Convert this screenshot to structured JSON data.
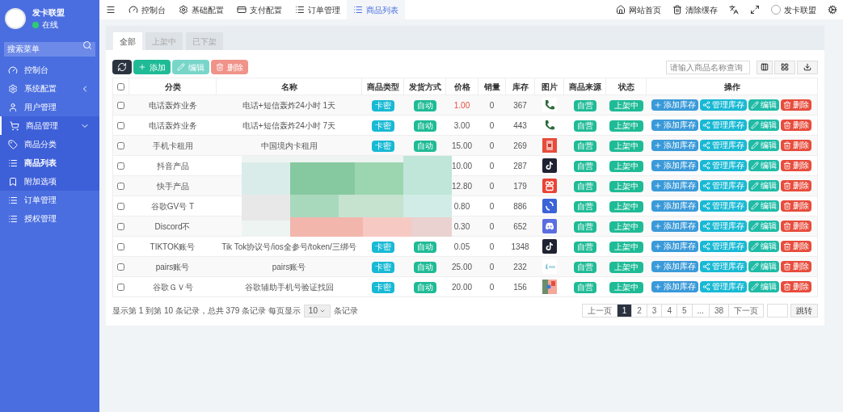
{
  "sidebar": {
    "user": {
      "name": "发卡联盟",
      "status": "在线",
      "online": true
    },
    "search": {
      "placeholder": "搜索菜单"
    },
    "items": [
      {
        "label": "控制台",
        "selected": false
      },
      {
        "label": "系统配置",
        "selected": false,
        "expanded": false
      },
      {
        "label": "用户管理",
        "selected": false
      },
      {
        "label": "商品管理",
        "selected": false,
        "expanded": true,
        "children": [
          {
            "label": "商品分类",
            "selected": false
          },
          {
            "label": "商品列表",
            "selected": true
          },
          {
            "label": "附加选项",
            "selected": false
          }
        ]
      },
      {
        "label": "订单管理",
        "selected": false
      },
      {
        "label": "授权管理",
        "selected": false
      }
    ]
  },
  "topbar": {
    "tabs": [
      {
        "label": "控制台",
        "selected": false
      },
      {
        "label": "基础配置",
        "selected": false
      },
      {
        "label": "支付配置",
        "selected": false
      },
      {
        "label": "订单管理",
        "selected": false
      },
      {
        "label": "商品列表",
        "selected": true
      }
    ],
    "links": [
      "网站首页",
      "清除缓存"
    ],
    "user": "发卡联盟"
  },
  "filter_tabs": [
    {
      "label": "全部",
      "selected": true
    },
    {
      "label": "上架中",
      "selected": false
    },
    {
      "label": "已下架",
      "selected": false
    }
  ],
  "toolbar": {
    "buttons": [
      {
        "kind": "refresh"
      },
      {
        "kind": "add",
        "label": "添加"
      },
      {
        "kind": "edit",
        "label": "编辑",
        "disabled": true
      },
      {
        "kind": "delete",
        "label": "删除",
        "disabled": true
      }
    ],
    "search": {
      "placeholder": "请输入商品名称查询"
    }
  },
  "table": {
    "select_all_checked": false,
    "columns": [
      "分类",
      "名称",
      "商品类型",
      "发货方式",
      "价格",
      "销量",
      "库存",
      "图片",
      "商品来源",
      "状态",
      "操作"
    ],
    "rows": [
      {
        "checked": false,
        "category": "电话轰炸业务",
        "name": "电话+短信轰炸24小时 1天",
        "type": "卡密",
        "delivery": "自动",
        "price": "1.00",
        "price_alert": true,
        "sales": "0",
        "stock": "367",
        "image": {
          "kind": "phone"
        },
        "source": "自营",
        "status": "上架中",
        "actions": [
          {
            "kind": "add",
            "label": "添加库存"
          },
          {
            "kind": "manage",
            "label": "管理库存"
          },
          {
            "kind": "edit",
            "label": "编辑"
          },
          {
            "kind": "delete",
            "label": "删除"
          }
        ]
      },
      {
        "checked": false,
        "category": "电话轰炸业务",
        "name": "电话+短信轰炸24小时 7天",
        "type": "卡密",
        "delivery": "自动",
        "price": "3.00",
        "price_alert": false,
        "sales": "0",
        "stock": "443",
        "image": {
          "kind": "phone"
        },
        "source": "自营",
        "status": "上架中",
        "actions": [
          {
            "kind": "add",
            "label": "添加库存"
          },
          {
            "kind": "manage",
            "label": "管理库存"
          },
          {
            "kind": "edit",
            "label": "编辑"
          },
          {
            "kind": "delete",
            "label": "删除"
          }
        ]
      },
      {
        "checked": false,
        "category": "手机卡租用",
        "name": "中国境内卡租用",
        "type": "卡密",
        "delivery": "自动",
        "price": "15.00",
        "price_alert": false,
        "sales": "0",
        "stock": "269",
        "image": {
          "kind": "sim"
        },
        "source": "自营",
        "status": "上架中",
        "actions": [
          {
            "kind": "add",
            "label": "添加库存"
          },
          {
            "kind": "manage",
            "label": "管理库存"
          },
          {
            "kind": "edit",
            "label": "编辑"
          },
          {
            "kind": "delete",
            "label": "删除"
          }
        ]
      },
      {
        "checked": false,
        "category": "抖音产品",
        "price": "10.00",
        "price_alert": false,
        "sales": "0",
        "stock": "287",
        "image": {
          "kind": "tiktok"
        },
        "source": "自营",
        "status": "上架中",
        "actions": [
          {
            "kind": "add",
            "label": "添加库存"
          },
          {
            "kind": "manage",
            "label": "管理库存"
          },
          {
            "kind": "edit",
            "label": "编辑"
          },
          {
            "kind": "delete",
            "label": "删除"
          }
        ]
      },
      {
        "checked": false,
        "category": "快手产品",
        "price": "12.80",
        "price_alert": false,
        "sales": "0",
        "stock": "179",
        "image": {
          "kind": "kuaishou"
        },
        "source": "自营",
        "status": "上架中",
        "actions": [
          {
            "kind": "add",
            "label": "添加库存"
          },
          {
            "kind": "manage",
            "label": "管理库存"
          },
          {
            "kind": "edit",
            "label": "编辑"
          },
          {
            "kind": "delete",
            "label": "删除"
          }
        ]
      },
      {
        "checked": false,
        "category": "谷歌GV号 T",
        "price": "0.80",
        "price_alert": false,
        "sales": "0",
        "stock": "886",
        "image": {
          "kind": "sync"
        },
        "source": "自营",
        "status": "上架中",
        "actions": [
          {
            "kind": "add",
            "label": "添加库存"
          },
          {
            "kind": "manage",
            "label": "管理库存"
          },
          {
            "kind": "edit",
            "label": "编辑"
          },
          {
            "kind": "delete",
            "label": "删除"
          }
        ]
      },
      {
        "checked": false,
        "category": "Discord不",
        "price": "0.30",
        "price_alert": false,
        "sales": "0",
        "stock": "652",
        "image": {
          "kind": "discord"
        },
        "source": "自营",
        "status": "上架中",
        "actions": [
          {
            "kind": "add",
            "label": "添加库存"
          },
          {
            "kind": "manage",
            "label": "管理库存"
          },
          {
            "kind": "edit",
            "label": "编辑"
          },
          {
            "kind": "delete",
            "label": "删除"
          }
        ]
      },
      {
        "checked": false,
        "category": "TIKTOK账号",
        "name": "Tik Tok协议号/ios全参号/token/三绑号",
        "type": "卡密",
        "delivery": "自动",
        "price": "0.05",
        "price_alert": false,
        "sales": "0",
        "stock": "1348",
        "image": {
          "kind": "tiktok"
        },
        "source": "自营",
        "status": "上架中",
        "actions": [
          {
            "kind": "add",
            "label": "添加库存"
          },
          {
            "kind": "manage",
            "label": "管理库存"
          },
          {
            "kind": "edit",
            "label": "编辑"
          },
          {
            "kind": "delete",
            "label": "删除"
          }
        ]
      },
      {
        "checked": false,
        "category": "pairs账号",
        "name": "pairs账号",
        "type": "卡密",
        "delivery": "自动",
        "price": "25.00",
        "price_alert": false,
        "sales": "0",
        "stock": "232",
        "image": {
          "kind": "pairs"
        },
        "source": "自营",
        "status": "上架中",
        "actions": [
          {
            "kind": "add",
            "label": "添加库存"
          },
          {
            "kind": "manage",
            "label": "管理库存"
          },
          {
            "kind": "edit",
            "label": "编辑"
          },
          {
            "kind": "delete",
            "label": "删除"
          }
        ]
      },
      {
        "checked": false,
        "category": "谷歌ＧＶ号",
        "name": "谷歌辅助手机号验证找回",
        "type": "卡密",
        "delivery": "自动",
        "price": "20.00",
        "price_alert": false,
        "sales": "0",
        "stock": "156",
        "image": {
          "kind": "map"
        },
        "source": "自营",
        "status": "上架中",
        "actions": [
          {
            "kind": "add",
            "label": "添加库存"
          },
          {
            "kind": "manage",
            "label": "管理库存"
          },
          {
            "kind": "edit",
            "label": "编辑"
          },
          {
            "kind": "delete",
            "label": "删除"
          }
        ]
      }
    ]
  },
  "footer": {
    "summary_before": "显示第 1 到第 10 条记录，总共 379 条记录 每页显示",
    "page_size": "10",
    "summary_after": "条记录",
    "pages": [
      {
        "label": "上一页",
        "selected": false
      },
      {
        "label": "1",
        "selected": true
      },
      {
        "label": "2",
        "selected": false
      },
      {
        "label": "3",
        "selected": false
      },
      {
        "label": "4",
        "selected": false
      },
      {
        "label": "5",
        "selected": false
      },
      {
        "label": "...",
        "selected": false
      },
      {
        "label": "38",
        "selected": false
      },
      {
        "label": "下一页",
        "selected": false
      }
    ],
    "jump": "跳转"
  }
}
